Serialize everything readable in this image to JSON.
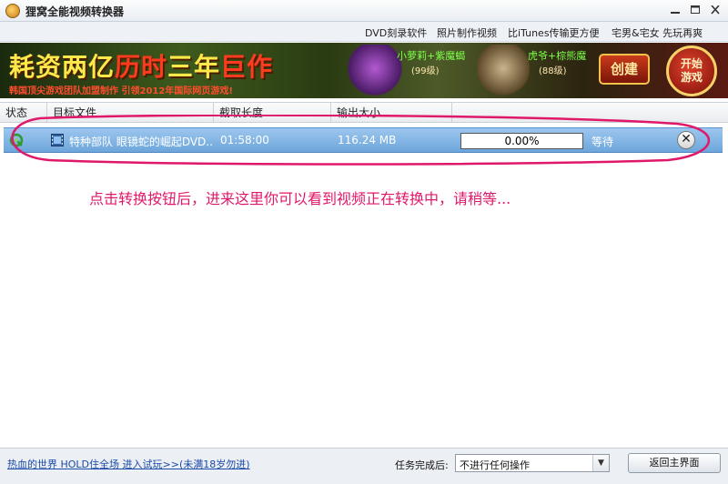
{
  "window": {
    "title": "狸窝全能视频转换器",
    "min": "—",
    "max": "□",
    "close": "✕"
  },
  "menu": [
    {
      "label": "DVD刻录软件"
    },
    {
      "label": "照片制作视频"
    },
    {
      "label": "比iTunes传输更方便"
    },
    {
      "label": "宅男&宅女 先玩再爽"
    }
  ],
  "banner": {
    "headline_yellow": "耗资两亿",
    "headline_red": "历时",
    "headline_yellow2": "三年",
    "headline_red2": "巨作",
    "subline": "韩国顶尖游戏团队加盟制作 引领2012年国际网页游戏!",
    "char1_name": "小萝莉+紫魔蝎",
    "char1_level": "(99级)",
    "char2_name": "虎爷+棕熊魔",
    "char2_level": "(88级)",
    "create_button": "创建",
    "play_button_line1": "开始",
    "play_button_line2": "游戏"
  },
  "table": {
    "columns": [
      "状态",
      "目标文件",
      "截取长度",
      "输出大小",
      ""
    ],
    "rows": [
      {
        "file": "特种部队 眼镜蛇的崛起DVD...",
        "duration": "01:58:00",
        "size": "116.24 MB",
        "progress_text": "0.00%",
        "progress": 0.0,
        "state": "等待",
        "remove": "✕"
      }
    ]
  },
  "annotation": {
    "text": "点击转换按钮后，进来这里你可以看到视频正在转换中，请稍等...",
    "color": "#e0186a"
  },
  "footer": {
    "ad_link": "热血的世界 HOLD住全场 进入试玩>>(未满18岁勿进)",
    "task_label": "任务完成后:",
    "task_value": "不进行任何操作",
    "back_button": "返回主界面"
  }
}
